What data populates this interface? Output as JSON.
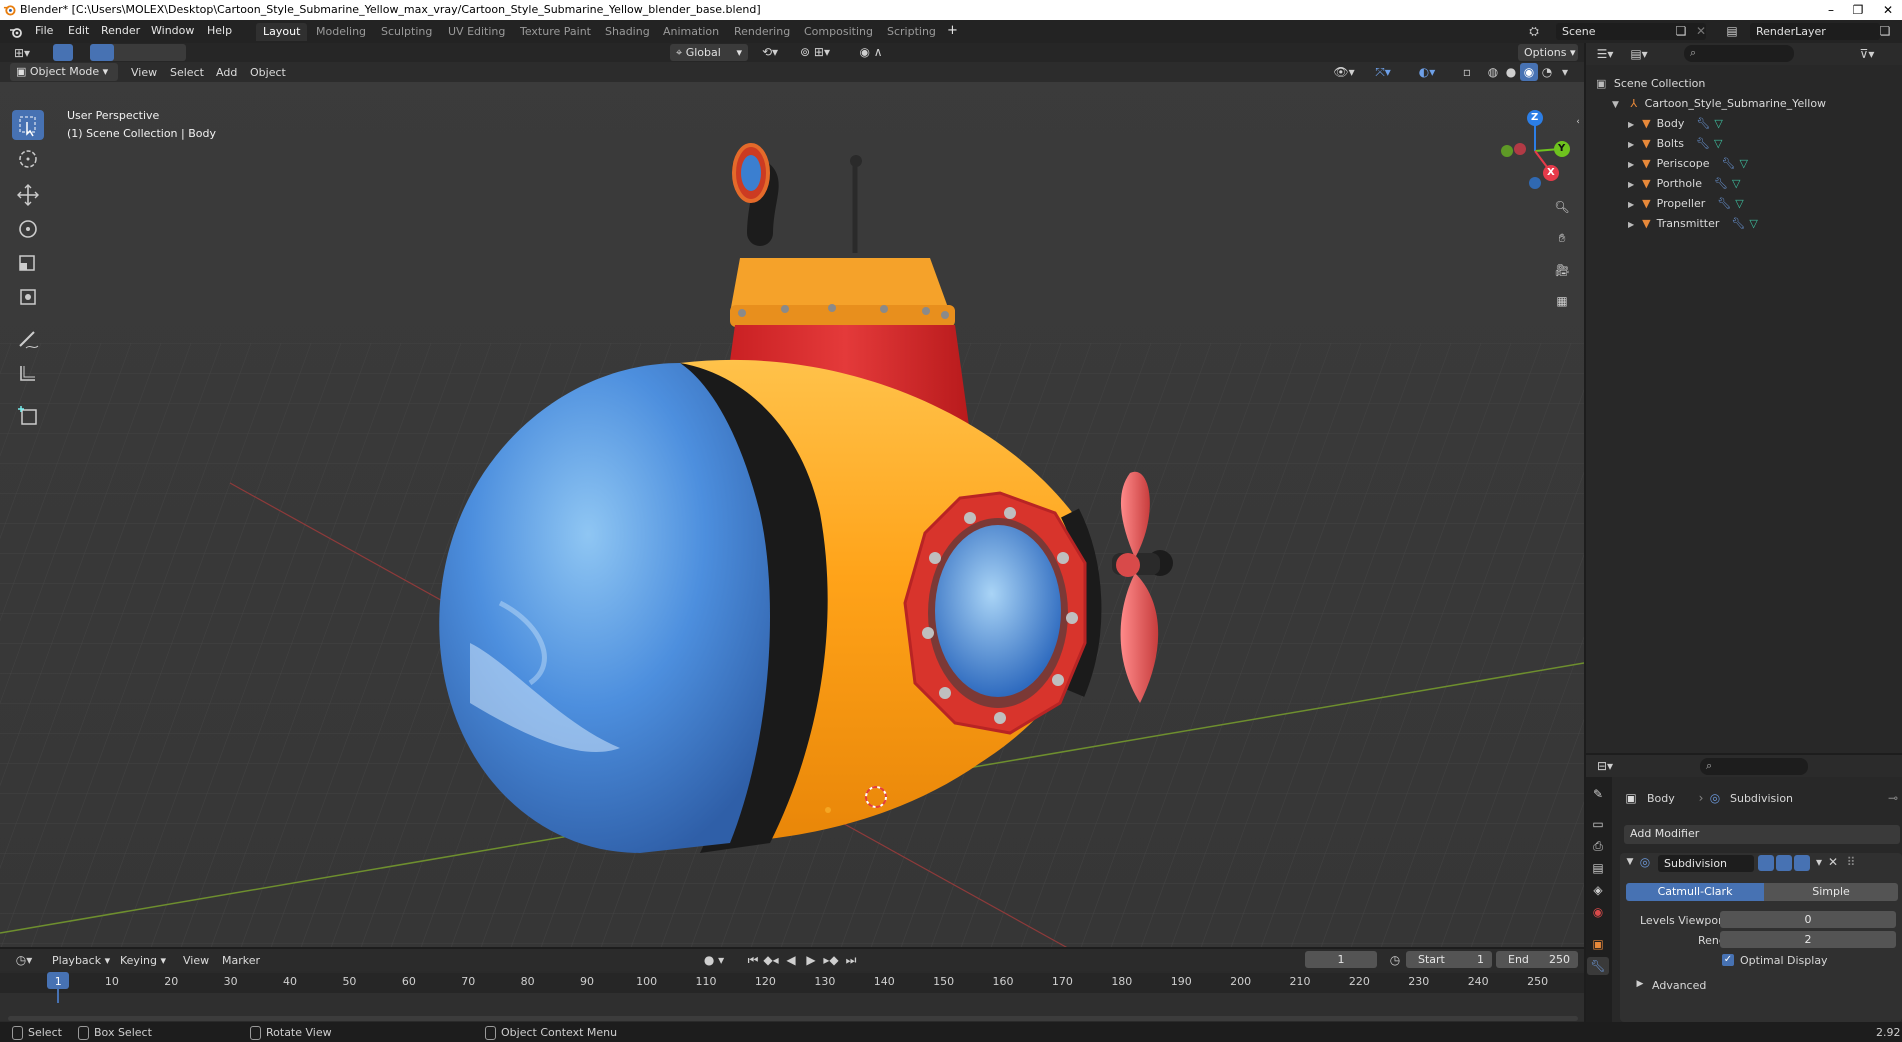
{
  "window": {
    "title": "Blender* [C:\\Users\\MOLEX\\Desktop\\Cartoon_Style_Submarine_Yellow_max_vray/Cartoon_Style_Submarine_Yellow_blender_base.blend]",
    "minimize": "–",
    "maximize": "❐",
    "close": "✕"
  },
  "menubar": {
    "items": [
      "File",
      "Edit",
      "Render",
      "Window",
      "Help"
    ],
    "workspaces": [
      "Layout",
      "Modeling",
      "Sculpting",
      "UV Editing",
      "Texture Paint",
      "Shading",
      "Animation",
      "Rendering",
      "Compositing",
      "Scripting"
    ],
    "add_workspace": "+",
    "scene": "Scene",
    "view_layer": "RenderLayer"
  },
  "viewport": {
    "mode": "Object Mode",
    "menus": [
      "View",
      "Select",
      "Add",
      "Object"
    ],
    "transform_orientation": "Global",
    "options": "Options",
    "info_line1": "User Perspective",
    "info_line2": "(1) Scene Collection | Body",
    "gizmo": {
      "z": "Z",
      "y": "Y",
      "x": "X"
    }
  },
  "outliner": {
    "root": "Scene Collection",
    "collection": "Cartoon_Style_Submarine_Yellow",
    "objects": [
      "Body",
      "Bolts",
      "Periscope",
      "Porthole",
      "Propeller",
      "Transmitter"
    ]
  },
  "properties": {
    "object": "Body",
    "modifier_breadcrumb": "Subdivision",
    "add_modifier": "Add Modifier",
    "modifier_name": "Subdivision",
    "type_a": "Catmull-Clark",
    "type_b": "Simple",
    "levels_viewport_label": "Levels Viewport",
    "levels_viewport_value": "0",
    "render_label": "Render",
    "render_value": "2",
    "optimal_display": "Optimal Display",
    "advanced": "Advanced"
  },
  "timeline": {
    "menus": [
      "Playback",
      "Keying",
      "View",
      "Marker"
    ],
    "current_frame": "1",
    "start_label": "Start",
    "start_value": "1",
    "end_label": "End",
    "end_value": "250",
    "ticks": [
      "1",
      "10",
      "20",
      "30",
      "40",
      "50",
      "60",
      "70",
      "80",
      "90",
      "100",
      "110",
      "120",
      "130",
      "140",
      "150",
      "160",
      "170",
      "180",
      "190",
      "200",
      "210",
      "220",
      "230",
      "240",
      "250"
    ]
  },
  "statusbar": {
    "select": "Select",
    "box_select": "Box Select",
    "rotate_view": "Rotate View",
    "context_menu": "Object Context Menu",
    "version": "2.92"
  },
  "colors": {
    "accent": "#4772b3",
    "object_icon": "#e8893a",
    "modifier_icon": "#6b97d8",
    "mesh_icon": "#3fbf9f"
  }
}
